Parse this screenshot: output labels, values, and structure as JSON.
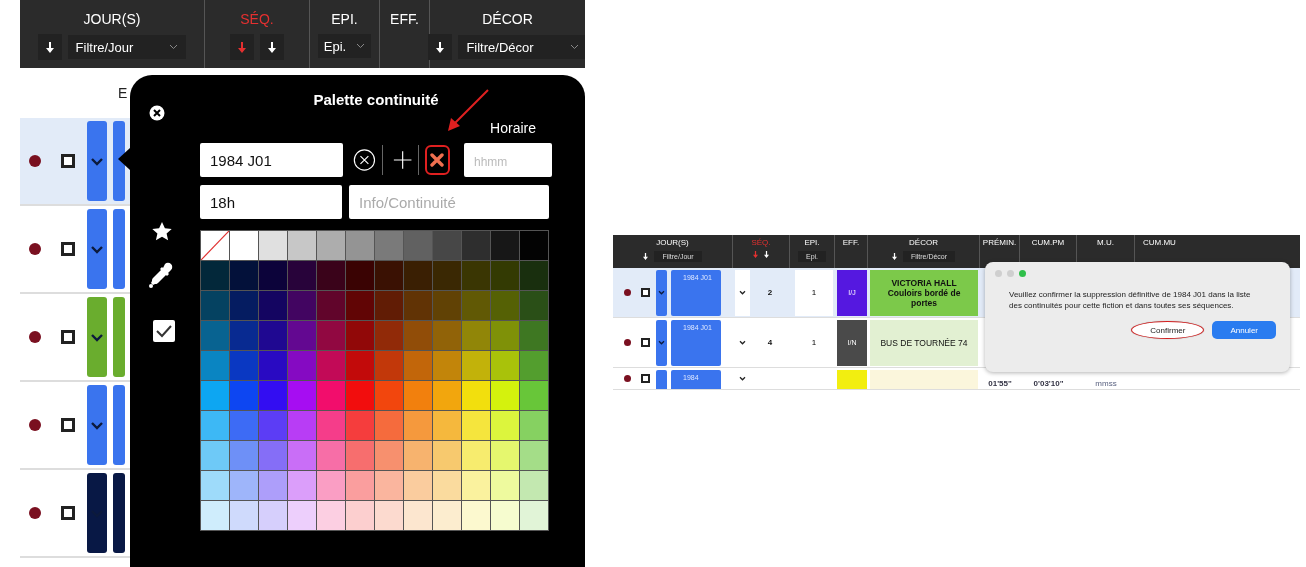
{
  "palette_view": {
    "header": {
      "columns": [
        {
          "label": "JOUR(S)",
          "kind": "filter",
          "filter": "Filtre/Jour"
        },
        {
          "label": "SÉQ.",
          "kind": "sort",
          "active": true
        },
        {
          "label": "EPI.",
          "kind": "select",
          "filter": "Epi."
        },
        {
          "label": "EFF.",
          "kind": "plain"
        },
        {
          "label": "DÉCOR",
          "kind": "filter",
          "filter": "Filtre/Décor"
        }
      ]
    },
    "column_label": "E",
    "rows": [
      {
        "color": "#3a74ee",
        "selected": true
      },
      {
        "color": "#3a74ee",
        "selected": false
      },
      {
        "color": "#6aad2e",
        "selected": false
      },
      {
        "color": "#3a74ee",
        "selected": false
      },
      {
        "color": "#081845",
        "selected": false
      }
    ],
    "popover": {
      "title": "Palette continuité",
      "horaire_label": "Horaire",
      "name_value": "1984 J01",
      "horaire_placeholder": "hhmm",
      "time_value": "18h",
      "info_placeholder": "Info/Continuité",
      "delete_annotated": true,
      "show_checked": true
    }
  },
  "dialog_view": {
    "header": {
      "columns": [
        {
          "label": "JOUR(S)",
          "kind": "filter",
          "filter": "Filtre/Jour"
        },
        {
          "label": "SÉQ.",
          "kind": "sort",
          "active": true
        },
        {
          "label": "EPI.",
          "kind": "select",
          "filter": "Epi."
        },
        {
          "label": "EFF.",
          "kind": "plain"
        },
        {
          "label": "DÉCOR",
          "kind": "filter",
          "filter": "Filtre/Décor"
        },
        {
          "label": "PRÉMIN.",
          "kind": "plain"
        },
        {
          "label": "CUM.PM",
          "kind": "plain"
        },
        {
          "label": "M.U.",
          "kind": "plain"
        },
        {
          "label": "CUM.MU",
          "kind": "plain"
        }
      ]
    },
    "rows": [
      {
        "selected": true,
        "day": "1984 J01",
        "seq": "2",
        "epi": "1",
        "eff": {
          "text": "I/J",
          "color": "#5518e0"
        },
        "decor": {
          "text": "VICTORIA HALL Couloirs bordé de portes",
          "color": "#7cc94a"
        }
      },
      {
        "selected": false,
        "day": "1984 J01",
        "seq": "4",
        "epi": "1",
        "eff": {
          "text": "I/N",
          "color": "#4a4a4a"
        },
        "decor": {
          "text": "BUS DE TOURNÉE 74",
          "color": "#e2f0d2"
        }
      },
      {
        "selected": false,
        "day": "1984",
        "eff": {
          "color": "#f2ee10"
        },
        "decor": {
          "color": "#fbf6dc"
        },
        "premin": "01'55\"",
        "cum_pm": "0'03'10\"",
        "mu": "mmss"
      }
    ],
    "dialog": {
      "message": "Veuillez confirmer la suppression définitive de 1984 J01  dans la liste des continuités pour cette fiction et dans toutes ses séquences.",
      "buttons": [
        {
          "label": "Confirmer",
          "kind": "default",
          "annotated": true
        },
        {
          "label": "Annuler",
          "kind": "primary",
          "annotated": false
        }
      ]
    }
  }
}
